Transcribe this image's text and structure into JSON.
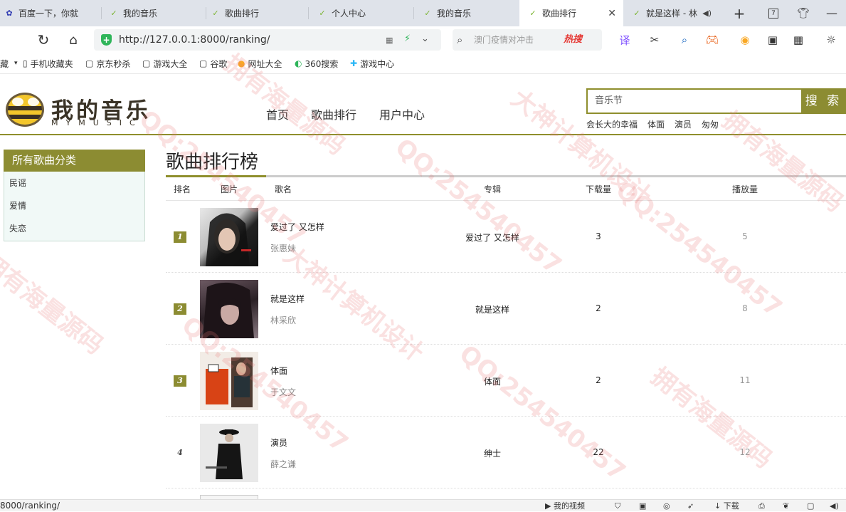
{
  "browser": {
    "tabs": [
      {
        "label": "百度一下，你就",
        "icon": "baidu-icon"
      },
      {
        "label": "我的音乐",
        "icon": "music-site-icon"
      },
      {
        "label": "歌曲排行",
        "icon": "music-site-icon"
      },
      {
        "label": "个人中心",
        "icon": "music-site-icon"
      },
      {
        "label": "我的音乐",
        "icon": "music-site-icon"
      },
      {
        "label": "歌曲排行",
        "icon": "music-site-icon",
        "active": true
      },
      {
        "label": "就是这样 - 林",
        "icon": "music-site-icon"
      }
    ],
    "tab_count": "7",
    "url": "http://127.0.0.1:8000/ranking/",
    "search_placeholder": "澳门疫情对冲击",
    "hot_label": "热搜",
    "bookmarks": [
      "藏",
      "手机收藏夹",
      "京东秒杀",
      "游戏大全",
      "谷歌",
      "网址大全",
      "360搜索",
      "游戏中心"
    ],
    "status_url": "8000/ranking/",
    "status_items": [
      "我的视频",
      "下载"
    ]
  },
  "site": {
    "brand": "我的音乐",
    "brand_sub": "MYMUSIC",
    "nav": [
      "首页",
      "歌曲排行",
      "用户中心"
    ],
    "search_value": "音乐节",
    "search_button": "搜 索",
    "hot_words": [
      "会长大的幸福",
      "体面",
      "演员",
      "匆匆"
    ]
  },
  "sidebar": {
    "title": "所有歌曲分类",
    "items": [
      "民谣",
      "爱情",
      "失恋"
    ]
  },
  "ranking": {
    "title": "歌曲排行榜",
    "headers": {
      "rank": "排名",
      "cover": "图片",
      "song": "歌名",
      "album": "专辑",
      "downloads": "下载量",
      "plays": "播放量"
    },
    "rows": [
      {
        "rank": "1",
        "song": "爱过了 又怎样",
        "singer": "张惠妹",
        "album": "爱过了 又怎样",
        "downloads": "3",
        "plays": "5"
      },
      {
        "rank": "2",
        "song": "就是这样",
        "singer": "林采欣",
        "album": "就是这样",
        "downloads": "2",
        "plays": "8"
      },
      {
        "rank": "3",
        "song": "体面",
        "singer": "于文文",
        "album": "体面",
        "downloads": "2",
        "plays": "11"
      },
      {
        "rank": "4",
        "song": "演员",
        "singer": "薛之谦",
        "album": "绅士",
        "downloads": "22",
        "plays": "12"
      }
    ]
  },
  "watermark": {
    "texts": [
      "QQ:254540457",
      "大神计算机设计",
      "拥有海量源码"
    ],
    "color": "#e67878"
  },
  "colors": {
    "accent": "#8c8c32",
    "accent_border": "#8f8f2d"
  }
}
